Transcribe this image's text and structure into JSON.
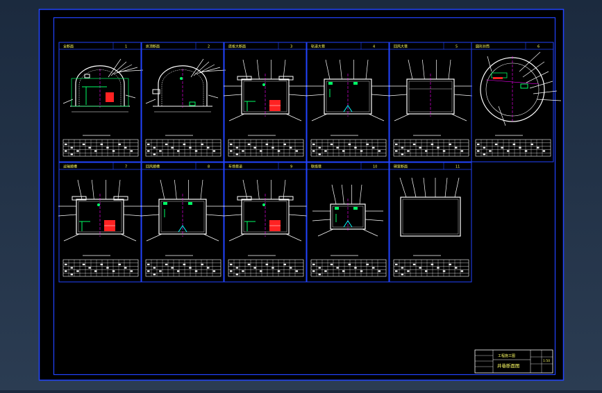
{
  "colors": {
    "frame": "#2244ff",
    "line": "#ffffff",
    "label": "#ffff66",
    "accent": "#00ff66",
    "magenta": "#ff00ff",
    "red": "#ff2222",
    "cyan": "#00ffff"
  },
  "sheets": [
    {
      "title": "全断面",
      "num": "1"
    },
    {
      "title": "拱顶断面",
      "num": "2"
    },
    {
      "title": "底板大断面",
      "num": "3"
    },
    {
      "title": "轨道大巷",
      "num": "4"
    },
    {
      "title": "回风大巷",
      "num": "5"
    },
    {
      "title": "圆形井筒",
      "num": "6"
    },
    {
      "title": "运输顺槽",
      "num": "7"
    },
    {
      "title": "回风顺槽",
      "num": "8"
    },
    {
      "title": "车场巷道",
      "num": "9"
    },
    {
      "title": "联络巷",
      "num": "10"
    },
    {
      "title": "硐室断面",
      "num": "11"
    }
  ],
  "title_block": {
    "title": "井巷断面图",
    "subtitle": "工程施工图",
    "scale": "1:50"
  }
}
